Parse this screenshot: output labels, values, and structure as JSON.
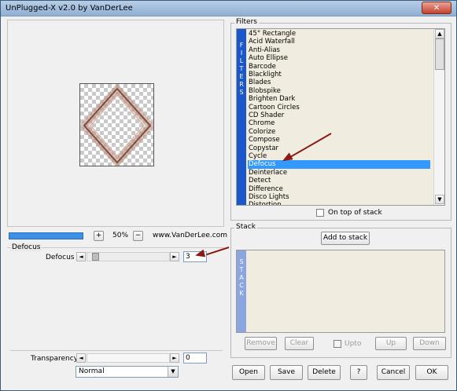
{
  "window": {
    "title": "UnPlugged-X v2.0 by VanDerLee",
    "close_glyph": "✕"
  },
  "preview": {
    "zoom_plus": "+",
    "zoom_value": "50%",
    "zoom_minus": "−",
    "website": "www.VanDerLee.com"
  },
  "defocus_group": {
    "label": "Defocus",
    "param_label": "Defocus",
    "value": "3"
  },
  "transparency": {
    "label": "Transparency",
    "value": "0",
    "blend_mode": "Normal"
  },
  "filters_group": {
    "label": "Filters",
    "side_text": "F I L T E R S",
    "items": [
      "45° Rectangle",
      "Acid Waterfall",
      "Anti-Alias",
      "Auto Ellipse",
      "Barcode",
      "Blacklight",
      "Blades",
      "Blobspike",
      "Brighten Dark",
      "Cartoon Circles",
      "CD Shader",
      "Chrome",
      "Colorize",
      "Compose",
      "Copystar",
      "Cycle",
      "Defocus",
      "Deinterlace",
      "Detect",
      "Difference",
      "Disco Lights",
      "Distortion"
    ],
    "selected": "Defocus",
    "on_top_label": "On top of stack"
  },
  "stack_group": {
    "label": "Stack",
    "add_button": "Add to stack",
    "side_text": "S T A C K",
    "remove": "Remove",
    "clear": "Clear",
    "upto": "Upto",
    "up": "Up",
    "down": "Down"
  },
  "bottom_buttons": {
    "open": "Open",
    "save": "Save",
    "delete": "Delete",
    "help": "?",
    "cancel": "Cancel",
    "ok": "OK"
  },
  "colors": {
    "accent": "#1b57c9",
    "selection": "#3399ff",
    "annotation_arrow": "#8a1a14"
  }
}
